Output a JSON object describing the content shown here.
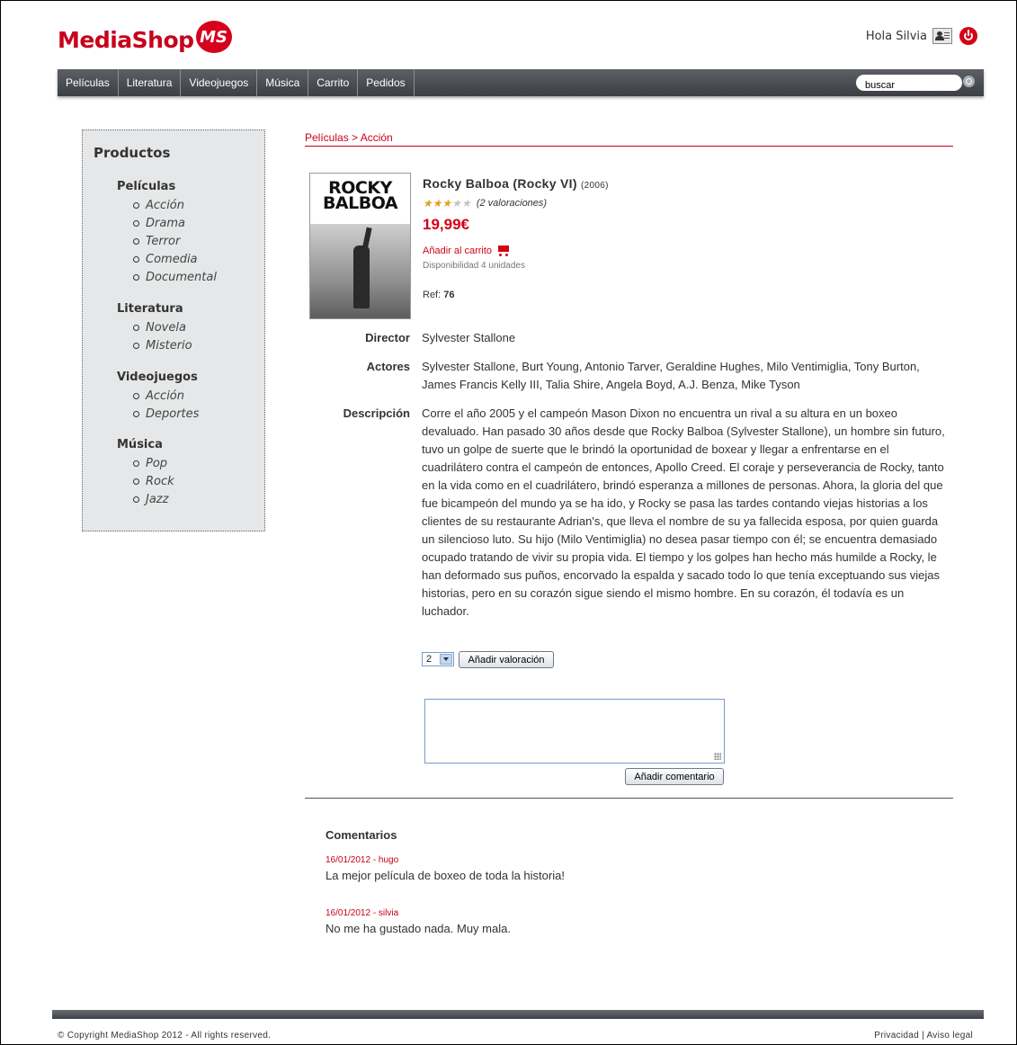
{
  "header": {
    "logo_text": "MediaShop",
    "logo_badge": "MS",
    "greeting": "Hola Silvia",
    "brand_color": "#c8001c"
  },
  "nav": {
    "items": [
      "Películas",
      "Literatura",
      "Videojuegos",
      "Música",
      "Carrito",
      "Pedidos"
    ],
    "search_value": "buscar"
  },
  "sidebar": {
    "title": "Productos",
    "categories": [
      {
        "label": "Películas",
        "subs": [
          "Acción",
          "Drama",
          "Terror",
          "Comedia",
          "Documental"
        ]
      },
      {
        "label": "Literatura",
        "subs": [
          "Novela",
          "Misterio"
        ]
      },
      {
        "label": "Videojuegos",
        "subs": [
          "Acción",
          "Deportes"
        ]
      },
      {
        "label": "Música",
        "subs": [
          "Pop",
          "Rock",
          "Jazz"
        ]
      }
    ]
  },
  "breadcrumb": "Películas > Acción",
  "product": {
    "poster_title": "ROCKY BALBOA",
    "title": "Rocky Balboa (Rocky VI)",
    "year": "(2006)",
    "stars_filled": 3,
    "stars_total": 5,
    "rating_text": "(2 valoraciones)",
    "price": "19,99€",
    "add_to_cart": "Añadir al carrito",
    "availability": "Disponibilidad 4 unidades",
    "ref_label": "Ref:",
    "ref_value": "76"
  },
  "details": {
    "director_label": "Director",
    "director_value": "Sylvester Stallone",
    "actors_label": "Actores",
    "actors_value": "Sylvester Stallone, Burt Young, Antonio Tarver, Geraldine Hughes, Milo Ventimiglia, Tony Burton, James Francis Kelly III, Talia Shire, Angela Boyd, A.J. Benza, Mike Tyson",
    "description_label": "Descripción",
    "description_value": "Corre el año 2005 y el campeón Mason Dixon no encuentra un rival a su altura en un boxeo devaluado. Han pasado 30 años desde que Rocky Balboa (Sylvester Stallone), un hombre sin futuro, tuvo un golpe de suerte que le brindó la oportunidad de boxear y llegar a enfrentarse en el cuadrilátero contra el campeón de entonces, Apollo Creed. El coraje y perseverancia de Rocky, tanto en la vida como en el cuadrilátero, brindó esperanza a millones de personas. Ahora, la gloria del que fue bicampeón del mundo ya se ha ido, y Rocky se pasa las tardes contando viejas historias a los clientes de su restaurante Adrian's, que lleva el nombre de su ya fallecida esposa, por quien guarda un silencioso luto. Su hijo (Milo Ventimiglia) no desea pasar tiempo con él; se encuentra demasiado ocupado tratando de vivir su propia vida. El tiempo y los golpes han hecho más humilde a Rocky, le han deformado sus puños, encorvado la espalda y sacado todo lo que tenía exceptuando sus viejas historias, pero en su corazón sigue siendo el mismo hombre. En su corazón, él todavía es un luchador."
  },
  "rating_form": {
    "selected": "2",
    "button": "Añadir valoración"
  },
  "comment_form": {
    "value": "",
    "button": "Añadir comentario"
  },
  "comments": {
    "title": "Comentarios",
    "items": [
      {
        "meta": "16/01/2012 - hugo",
        "text": "La mejor película de boxeo de toda la historia!"
      },
      {
        "meta": "16/01/2012 - silvia",
        "text": "No me ha gustado nada. Muy mala."
      }
    ]
  },
  "footer": {
    "copyright": "© Copyright MediaShop 2012 - All rights reserved.",
    "privacy": "Privacidad",
    "separator": "|",
    "legal": "Aviso legal"
  }
}
